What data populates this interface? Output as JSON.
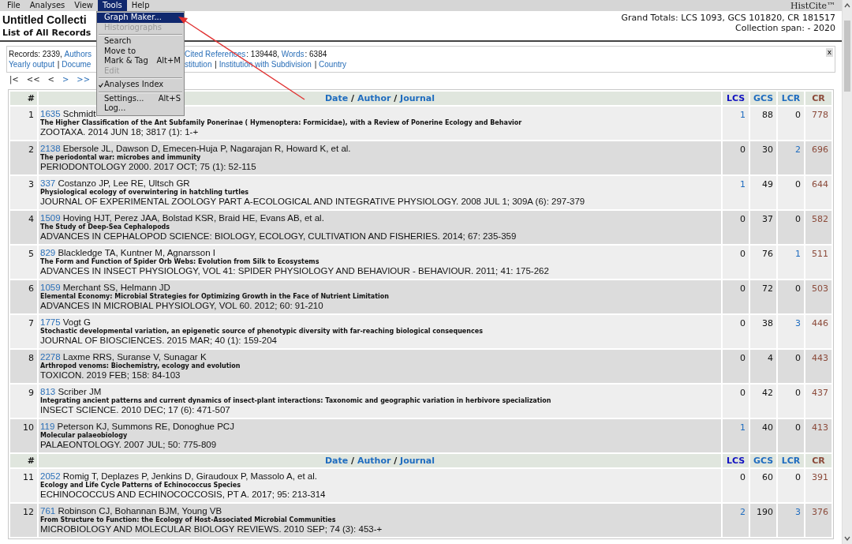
{
  "menu_bar": {
    "items": [
      {
        "label": "File",
        "selected": false
      },
      {
        "label": "Analyses",
        "selected": false
      },
      {
        "label": "View",
        "selected": false
      },
      {
        "label": "Tools",
        "selected": true
      },
      {
        "label": "Help",
        "selected": false
      }
    ],
    "app_name": "HistCite™"
  },
  "tools_menu": {
    "items": [
      {
        "kind": "item",
        "label": "Graph Maker...",
        "selected": true,
        "disabled": false,
        "checked": false
      },
      {
        "kind": "item",
        "label": "Historiographs",
        "selected": false,
        "disabled": true,
        "checked": false
      },
      {
        "kind": "separator"
      },
      {
        "kind": "item",
        "label": "Search",
        "selected": false,
        "disabled": false,
        "checked": false
      },
      {
        "kind": "item",
        "label": "Move to",
        "selected": false,
        "disabled": false,
        "checked": false
      },
      {
        "kind": "item",
        "label": "Mark & Tag",
        "shortcut": "Alt+M",
        "selected": false,
        "disabled": false,
        "checked": false
      },
      {
        "kind": "item",
        "label": "Edit",
        "selected": false,
        "disabled": true,
        "checked": false
      },
      {
        "kind": "separator"
      },
      {
        "kind": "item",
        "label": "Analyses Index",
        "selected": false,
        "disabled": false,
        "checked": true
      },
      {
        "kind": "separator"
      },
      {
        "kind": "item",
        "label": "Settings...",
        "shortcut": "Alt+S",
        "selected": false,
        "disabled": false,
        "checked": false
      },
      {
        "kind": "item",
        "label": "Log...",
        "selected": false,
        "disabled": false,
        "checked": false
      }
    ]
  },
  "header": {
    "title": "Untitled Collecti",
    "subtitle": "List of All Records",
    "totals": "Grand Totals: LCS 1093, GCS 101820, CR 181517",
    "span": "Collection span: - 2020"
  },
  "info_box": {
    "lines": [
      {
        "before_menu": [
          {
            "text": "Records: 2339, ",
            "link": false
          },
          {
            "text": "Authors",
            "link": true
          }
        ],
        "after_menu": [
          {
            "text": "Cited References",
            "link": true
          },
          {
            "text": ": 139448, ",
            "link": false
          },
          {
            "text": "Words",
            "link": true
          },
          {
            "text": ": 6384",
            "link": false
          }
        ]
      },
      {
        "before_menu": [
          {
            "text": "Yearly output",
            "link": true
          },
          {
            "text": " | ",
            "link": false
          },
          {
            "text": "Docume",
            "link": true
          }
        ],
        "after_menu": [
          {
            "text": "stitution",
            "link": true
          },
          {
            "text": " | ",
            "link": false
          },
          {
            "text": "Institution with Subdivision",
            "link": true
          },
          {
            "text": " | ",
            "link": false
          },
          {
            "text": "Country",
            "link": true
          }
        ]
      }
    ],
    "close": "x"
  },
  "pager": [
    {
      "label": "|<",
      "link": false
    },
    {
      "label": "<<",
      "link": false
    },
    {
      "label": "<",
      "link": false
    },
    {
      "label": ">",
      "link": true
    },
    {
      "label": ">>",
      "link": true
    }
  ],
  "table": {
    "sections": [
      {
        "header": {
          "number": "#",
          "sort_links": [
            "Date",
            "Author",
            "Journal"
          ],
          "separator": "/",
          "metrics": [
            "LCS",
            "GCS",
            "LCR",
            "CR"
          ]
        },
        "rows": [
          {
            "n": "1",
            "id": "1635",
            "authors": "Schmidt",
            "title": "The Higher Classification of the Ant Subfamily Ponerinae ( Hymenoptera: Formicidae), with a Review of Ponerine Ecology and Behavior",
            "source": "ZOOTAXA. 2014 JUN 18; 3817 (1): 1-+",
            "lcs": {
              "value": "1",
              "link": true
            },
            "gcs": "88",
            "lcr": {
              "value": "0",
              "link": false
            },
            "cr": "778"
          },
          {
            "n": "2",
            "id": "2138",
            "authors": "Ebersole JL, Dawson D, Emecen-Huja P, Nagarajan R, Howard K, et al.",
            "title": "The periodontal war: microbes and immunity",
            "source": "PERIODONTOLOGY 2000. 2017 OCT; 75 (1): 52-115",
            "lcs": {
              "value": "0",
              "link": false
            },
            "gcs": "30",
            "lcr": {
              "value": "2",
              "link": true
            },
            "cr": "696"
          },
          {
            "n": "3",
            "id": "337",
            "authors": "Costanzo JP, Lee RE, Ultsch GR",
            "title": "Physiological ecology of overwintering in hatchling turtles",
            "source": "JOURNAL OF EXPERIMENTAL ZOOLOGY PART A-ECOLOGICAL AND INTEGRATIVE PHYSIOLOGY. 2008 JUL 1; 309A (6): 297-379",
            "lcs": {
              "value": "1",
              "link": true
            },
            "gcs": "49",
            "lcr": {
              "value": "0",
              "link": false
            },
            "cr": "644"
          },
          {
            "n": "4",
            "id": "1509",
            "authors": "Hoving HJT, Perez JAA, Bolstad KSR, Braid HE, Evans AB, et al.",
            "title": "The Study of Deep-Sea Cephalopods",
            "source": "ADVANCES IN CEPHALOPOD SCIENCE: BIOLOGY, ECOLOGY, CULTIVATION AND FISHERIES. 2014; 67: 235-359",
            "lcs": {
              "value": "0",
              "link": false
            },
            "gcs": "37",
            "lcr": {
              "value": "0",
              "link": false
            },
            "cr": "582"
          },
          {
            "n": "5",
            "id": "829",
            "authors": "Blackledge TA, Kuntner M, Agnarsson I",
            "title": "The Form and Function of Spider Orb Webs: Evolution from Silk to Ecosystems",
            "source": "ADVANCES IN INSECT PHYSIOLOGY, VOL 41: SPIDER PHYSIOLOGY AND BEHAVIOUR - BEHAVIOUR. 2011; 41: 175-262",
            "lcs": {
              "value": "0",
              "link": false
            },
            "gcs": "76",
            "lcr": {
              "value": "1",
              "link": true
            },
            "cr": "511"
          },
          {
            "n": "6",
            "id": "1059",
            "authors": "Merchant SS, Helmann JD",
            "title": "Elemental Economy: Microbial Strategies for Optimizing Growth in the Face of Nutrient Limitation",
            "source": "ADVANCES IN MICROBIAL PHYSIOLOGY, VOL 60. 2012; 60: 91-210",
            "lcs": {
              "value": "0",
              "link": false
            },
            "gcs": "72",
            "lcr": {
              "value": "0",
              "link": false
            },
            "cr": "503"
          },
          {
            "n": "7",
            "id": "1775",
            "authors": "Vogt G",
            "title": "Stochastic developmental variation, an epigenetic source of phenotypic diversity with far-reaching biological consequences",
            "source": "JOURNAL OF BIOSCIENCES. 2015 MAR; 40 (1): 159-204",
            "lcs": {
              "value": "0",
              "link": false
            },
            "gcs": "38",
            "lcr": {
              "value": "3",
              "link": true
            },
            "cr": "446"
          },
          {
            "n": "8",
            "id": "2278",
            "authors": "Laxme RRS, Suranse V, Sunagar K",
            "title": "Arthropod venoms: Biochemistry, ecology and evolution",
            "source": "TOXICON. 2019 FEB; 158: 84-103",
            "lcs": {
              "value": "0",
              "link": false
            },
            "gcs": "4",
            "lcr": {
              "value": "0",
              "link": false
            },
            "cr": "443"
          },
          {
            "n": "9",
            "id": "813",
            "authors": "Scriber JM",
            "title": "Integrating ancient patterns and current dynamics of insect-plant interactions: Taxonomic and geographic variation in herbivore specialization",
            "source": "INSECT SCIENCE. 2010 DEC; 17 (6): 471-507",
            "lcs": {
              "value": "0",
              "link": false
            },
            "gcs": "42",
            "lcr": {
              "value": "0",
              "link": false
            },
            "cr": "437"
          },
          {
            "n": "10",
            "id": "119",
            "authors": "Peterson KJ, Summons RE, Donoghue PCJ",
            "title": "Molecular palaeobiology",
            "source": "PALAEONTOLOGY. 2007 JUL; 50: 775-809",
            "lcs": {
              "value": "1",
              "link": true
            },
            "gcs": "40",
            "lcr": {
              "value": "0",
              "link": false
            },
            "cr": "413"
          }
        ]
      },
      {
        "header": {
          "number": "#",
          "sort_links": [
            "Date",
            "Author",
            "Journal"
          ],
          "separator": "/",
          "metrics": [
            "LCS",
            "GCS",
            "LCR",
            "CR"
          ]
        },
        "rows": [
          {
            "n": "11",
            "id": "2052",
            "authors": "Romig T, Deplazes P, Jenkins D, Giraudoux P, Massolo A, et al.",
            "title": "Ecology and Life Cycle Patterns of Echinococcus Species",
            "source": "ECHINOCOCCUS AND ECHINOCOCCOSIS, PT A. 2017; 95: 213-314",
            "lcs": {
              "value": "0",
              "link": false
            },
            "gcs": "60",
            "lcr": {
              "value": "0",
              "link": false
            },
            "cr": "391"
          },
          {
            "n": "12",
            "id": "761",
            "authors": "Robinson CJ, Bohannan BJM, Young VB",
            "title": "From Structure to Function: the Ecology of Host-Associated Microbial Communities",
            "source": "MICROBIOLOGY AND MOLECULAR BIOLOGY REVIEWS. 2010 SEP; 74 (3): 453-+",
            "lcs": {
              "value": "2",
              "link": true
            },
            "gcs": "190",
            "lcr": {
              "value": "3",
              "link": true
            },
            "cr": "376"
          }
        ]
      }
    ]
  }
}
